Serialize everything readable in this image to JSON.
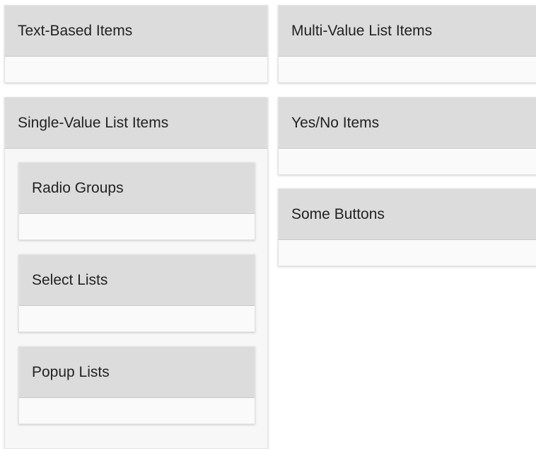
{
  "regions": {
    "text_based": {
      "title": "Text-Based Items"
    },
    "multi_value": {
      "title": "Multi-Value List Items"
    },
    "single_value": {
      "title": "Single-Value List Items",
      "subregions": {
        "radio_groups": {
          "title": "Radio Groups"
        },
        "select_lists": {
          "title": "Select Lists"
        },
        "popup_lists": {
          "title": "Popup Lists"
        }
      }
    },
    "yes_no": {
      "title": "Yes/No Items"
    },
    "some_buttons": {
      "title": "Some Buttons"
    }
  }
}
